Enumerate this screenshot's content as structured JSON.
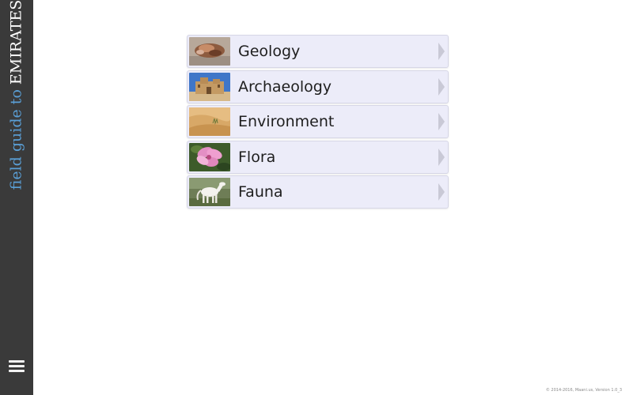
{
  "sidebar": {
    "title_part1": "field guide to ",
    "title_part2": "EMIRATES",
    "title_color1": "#5a9fd6",
    "title_color2": "#ffffff",
    "menu_icon": "hamburger-menu-icon"
  },
  "categories": [
    {
      "label": "Geology",
      "thumb": "rock-photo"
    },
    {
      "label": "Archaeology",
      "thumb": "fort-photo"
    },
    {
      "label": "Environment",
      "thumb": "desert-photo"
    },
    {
      "label": "Flora",
      "thumb": "flower-photo"
    },
    {
      "label": "Fauna",
      "thumb": "horse-photo"
    }
  ],
  "footer": {
    "text": "© 2014-2016, Maani.us, Version 1.0_3"
  },
  "colors": {
    "sidebar_bg": "#3a3a3a",
    "item_bg": "#ececf9",
    "accent_blue": "#5a9fd6"
  }
}
